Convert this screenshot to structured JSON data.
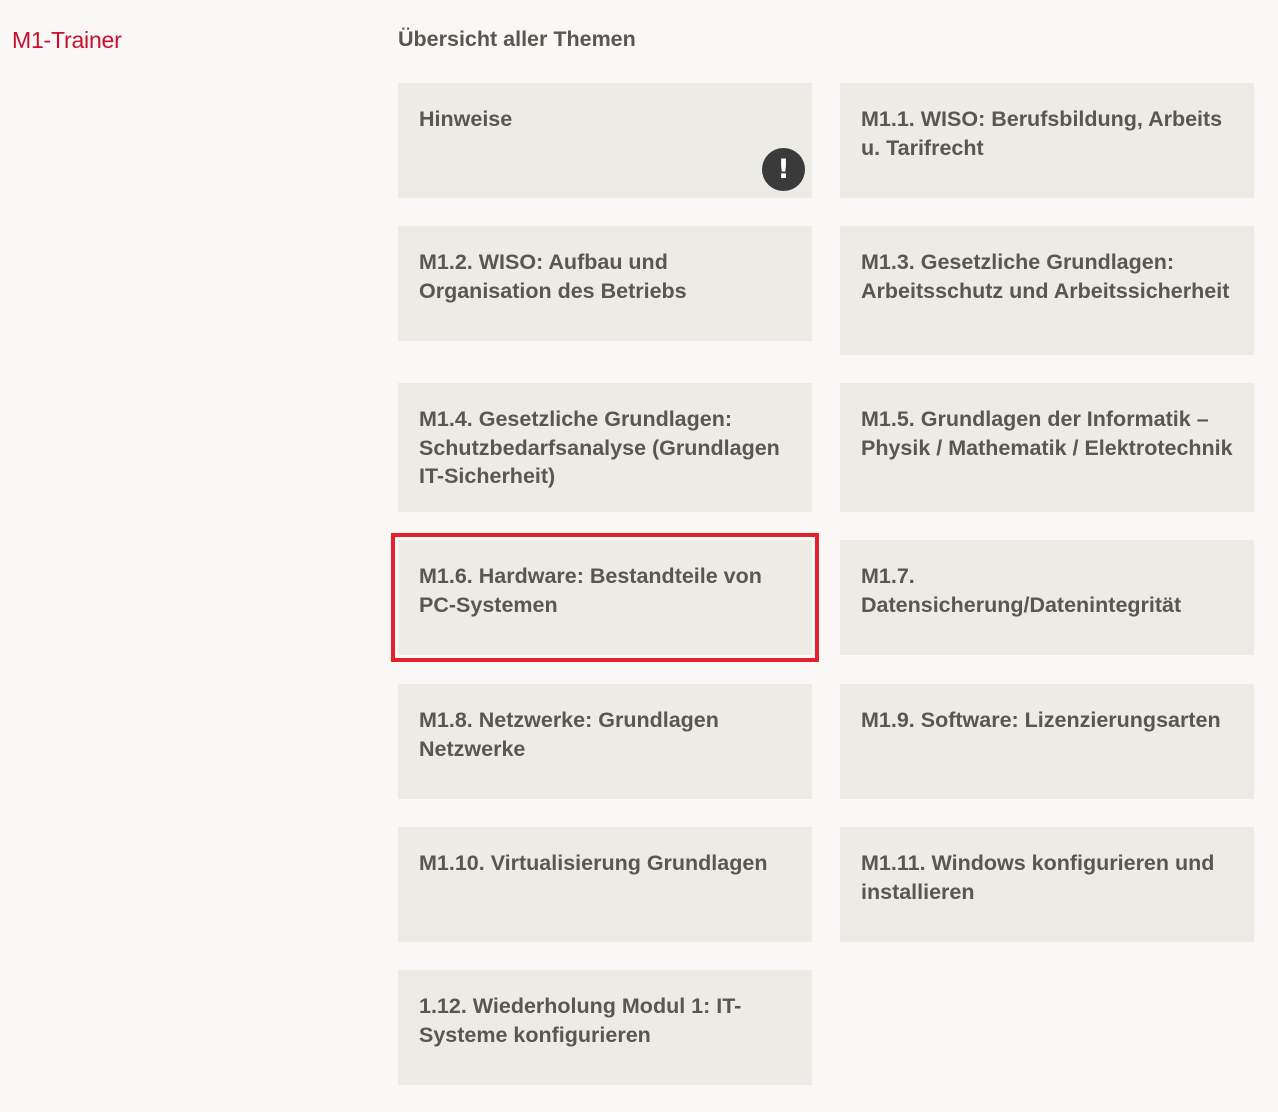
{
  "brand": "M1-Trainer",
  "heading": "Übersicht aller Themen",
  "tiles": [
    {
      "label": "Hinweise",
      "badge": "!"
    },
    {
      "label": "M1.1. WISO: Berufsbildung, Arbeits u. Tarifrecht"
    },
    {
      "label": "M1.2. WISO: Aufbau und Organisation des Betriebs"
    },
    {
      "label": "M1.3. Gesetzliche Grundlagen: Arbeitsschutz und Arbeitssicherheit"
    },
    {
      "label": "M1.4. Gesetzliche Grundlagen: Schutzbedarfsanalyse (Grundlagen IT-Sicherheit)"
    },
    {
      "label": "M1.5. Grundlagen der Informatik – Physik / Mathematik / Elektrotechnik"
    },
    {
      "label": "M1.6. Hardware: Bestandteile von PC-Systemen",
      "selected": true
    },
    {
      "label": "M1.7. Datensicherung/Datenintegrität"
    },
    {
      "label": "M1.8. Netzwerke: Grundlagen Netzwerke"
    },
    {
      "label": "M1.9. Software: Lizenzierungsarten"
    },
    {
      "label": "M1.10. Virtualisierung Grundlagen"
    },
    {
      "label": "M1.11. Windows konfigurieren und installieren"
    },
    {
      "label": "1.12. Wiederholung Modul 1: IT-Systeme konfigurieren"
    }
  ],
  "colors": {
    "brand": "#c8102e",
    "background": "#f9f8f6",
    "tile": "#edebe6",
    "text": "#5a5650",
    "highlight": "#e3222c",
    "badge": "#3a3a3a"
  }
}
